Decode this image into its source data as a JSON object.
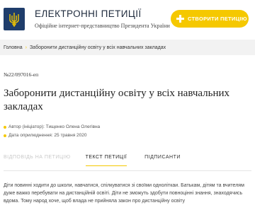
{
  "header": {
    "title": "ЕЛЕКТРОННІ ПЕТИЦІЇ",
    "subtitle": "Офіційне інтернет-представництво Президента України",
    "create_button_label": "СТВОРИТИ ПЕТИЦІЮ",
    "emblem_icon": "trident-icon",
    "emblem_color": "#1f3d6b",
    "accent_color": "#f5c800"
  },
  "breadcrumb": {
    "home": "Головна",
    "current": "Заборонити дистанційну освіту у всіх навчальних закладах"
  },
  "petition": {
    "number": "№22/097016-еп",
    "title": "Заборонити дистанційну освіту у всіх навчальних закладах",
    "author": "Автор (ініціатор): Тищенко Олена Олегівна",
    "date": "Дата оприлюднення: 25 травня 2020"
  },
  "tabs": [
    {
      "label": "ВІДПОВІДЬ НА ПЕТИЦІЮ",
      "state": "disabled"
    },
    {
      "label": "ТЕКСТ ПЕТИЦІЇ",
      "state": "active"
    },
    {
      "label": "ПІДПИСАНТИ",
      "state": "normal"
    }
  ],
  "body": {
    "text": "Діти повинні ходити до школи, навчатися, спілкуватися зі своїми одноліткаи. Батькам, дітям та вчителям дуже важко перебувати на дистанційній освіті. Діти не зможуть здобути повноцінні знання, знаходячись вдома. Тому народ хоче, щоб влада не прийняла закон про дистанційну освіту"
  }
}
